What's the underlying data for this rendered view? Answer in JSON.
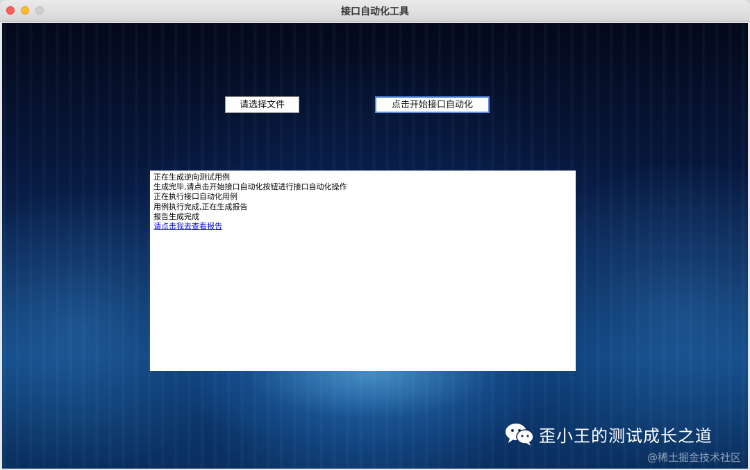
{
  "window": {
    "title": "接口自动化工具"
  },
  "toolbar": {
    "select_file_label": "请选择文件",
    "start_label": "点击开始接口自动化"
  },
  "log": {
    "lines": [
      "正在生成逆向测试用例",
      "生成完毕,请点击开始接口自动化按钮进行接口自动化操作",
      "正在执行接口自动化用例",
      "用例执行完成,正在生成报告",
      "报告生成完成"
    ],
    "report_link": "请点击我去查看报告"
  },
  "watermark": {
    "icon": "wechat-icon",
    "text": "歪小王的测试成长之道",
    "credit": "@稀土掘金技术社区"
  },
  "colors": {
    "link": "#0000ee",
    "close": "#fe5f57",
    "minimize": "#febc2e",
    "button_focus": "#5b8ee0"
  }
}
